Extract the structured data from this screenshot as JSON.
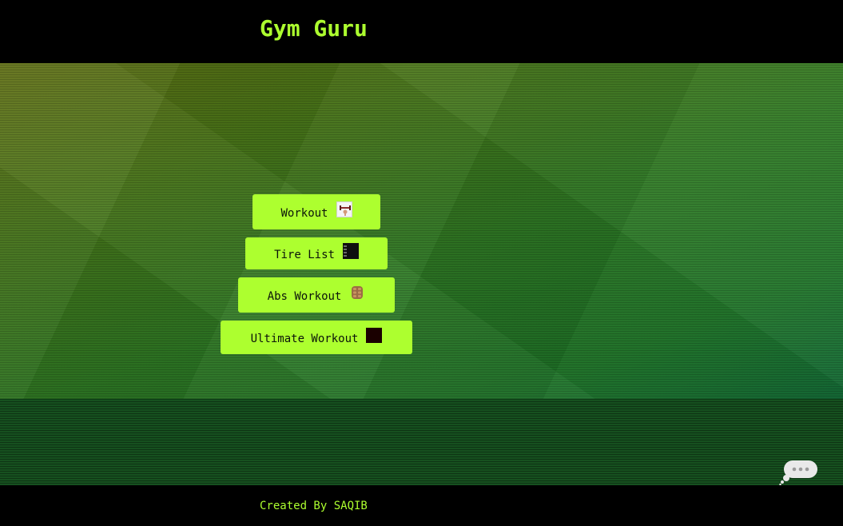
{
  "header": {
    "title": "Gym Guru"
  },
  "menu": {
    "items": [
      {
        "label": "Workout",
        "icon": "flexed-dumbbell-icon"
      },
      {
        "label": "Tire List",
        "icon": "list-board-icon"
      },
      {
        "label": "Abs Workout",
        "icon": "abs-icon"
      },
      {
        "label": "Ultimate Workout",
        "icon": "dark-square-icon"
      }
    ]
  },
  "footer": {
    "text": "Created By SAQIB"
  },
  "colors": {
    "accent": "#adff2f",
    "header_bg": "#000000",
    "button_text": "#0b140a"
  }
}
